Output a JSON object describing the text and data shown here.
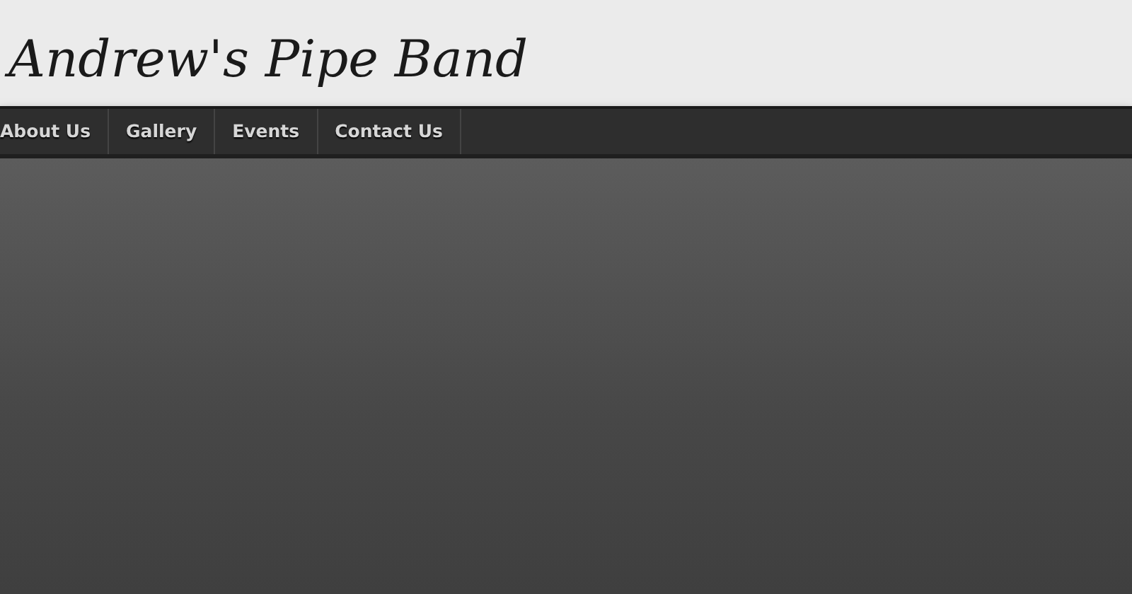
{
  "header": {
    "title": "Andrew's Pipe Band"
  },
  "nav": {
    "items": [
      {
        "label": "About Us"
      },
      {
        "label": "Gallery"
      },
      {
        "label": "Events"
      },
      {
        "label": "Contact Us"
      }
    ]
  }
}
